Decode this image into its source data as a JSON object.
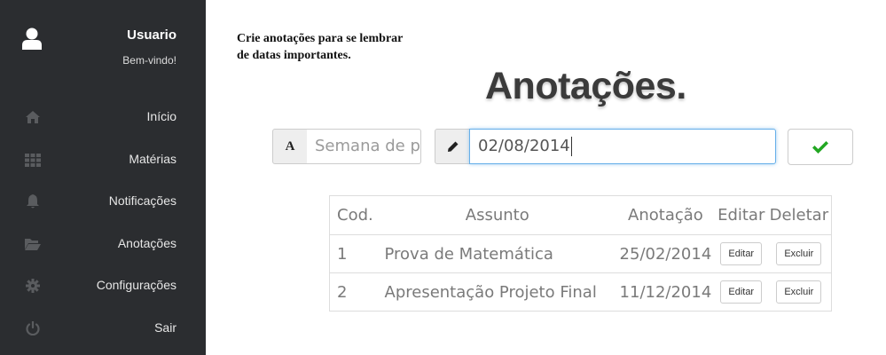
{
  "sidebar": {
    "user": {
      "name": "Usuario",
      "subtitle": "Bem-vindo!",
      "icon": "user-icon"
    },
    "items": [
      {
        "label": "Início",
        "icon": "home-icon"
      },
      {
        "label": "Matérias",
        "icon": "grid-icon"
      },
      {
        "label": "Notificações",
        "icon": "bell-icon"
      },
      {
        "label": "Anotações",
        "icon": "folder-open-icon"
      },
      {
        "label": "Configurações",
        "icon": "gear-icon"
      },
      {
        "label": "Sair",
        "icon": "power-icon"
      }
    ]
  },
  "main": {
    "intro": "Crie anotações para se lembrar de datas importantes.",
    "title": "Anotações.",
    "form": {
      "subject_addon": "A",
      "subject_value": "Semana de pr",
      "date_icon": "pencil-icon",
      "date_value": "02/08/2014",
      "confirm_icon": "check-icon"
    },
    "table": {
      "headers": [
        "Cod.",
        "Assunto",
        "Anotação",
        "Editar",
        "Deletar"
      ],
      "rows": [
        {
          "cod": "1",
          "subject": "Prova de Matemática",
          "date": "25/02/2014",
          "edit": "Editar",
          "delete": "Excluir"
        },
        {
          "cod": "2",
          "subject": "Apresentação Projeto Final",
          "date": "11/12/2014",
          "edit": "Editar",
          "delete": "Excluir"
        }
      ]
    }
  },
  "colors": {
    "sidebar_bg": "#2b2d30",
    "accent_green": "#22a722",
    "focus_blue": "#66afe9"
  }
}
